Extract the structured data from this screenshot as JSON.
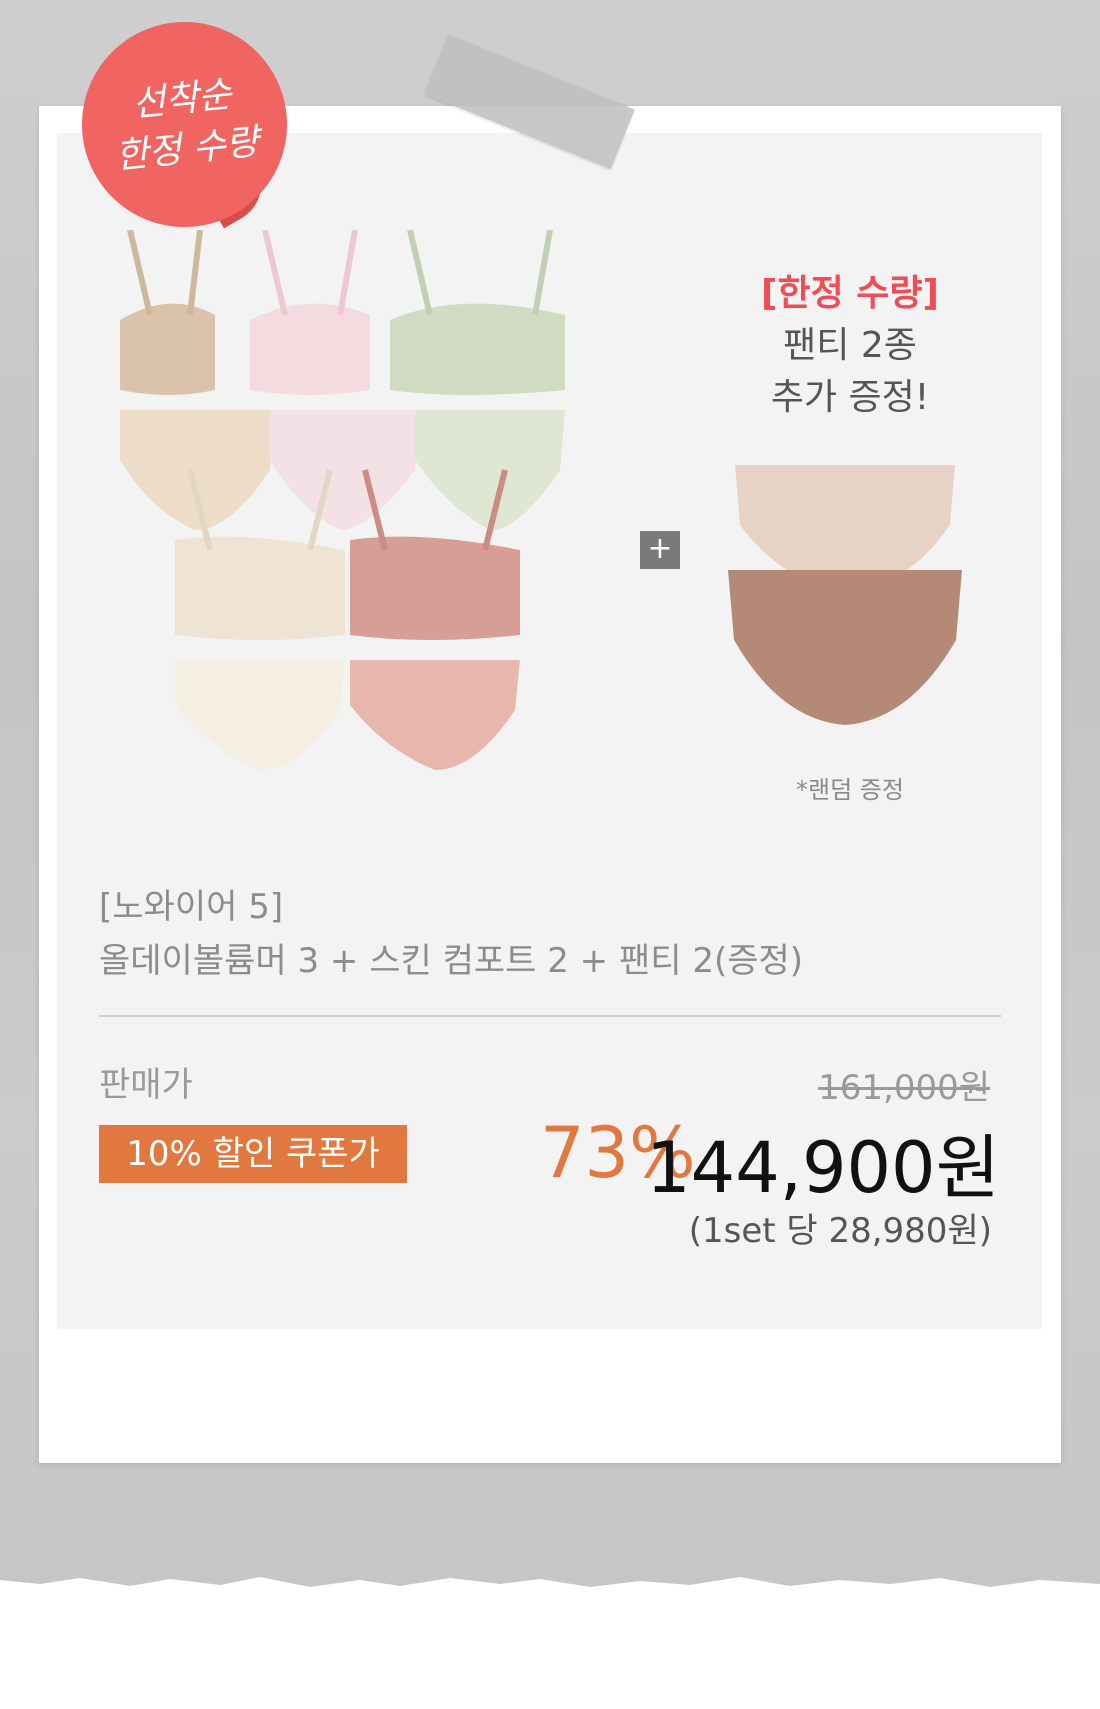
{
  "badge": {
    "line1": "선착순",
    "line2": "한정 수량"
  },
  "gift": {
    "title": "[한정 수량]",
    "line1": "팬티 2종",
    "line2": "추가 증정!",
    "note": "*랜덤 증정"
  },
  "plus_symbol": "+",
  "product": {
    "name_line1": "[노와이어 5]",
    "name_line2": "올데이볼륨머 3 + 스킨 컴포트 2 + 팬티 2(증정)"
  },
  "pricing": {
    "label": "판매가",
    "original_price": "161,000원",
    "coupon_label": "10% 할인 쿠폰가",
    "discount_rate": "73%",
    "final_price": "144,900원",
    "per_set": "(1set 당 28,980원)"
  },
  "colors": {
    "badge": "#f06462",
    "accent": "#e07840",
    "gift_title": "#ef4d55"
  }
}
